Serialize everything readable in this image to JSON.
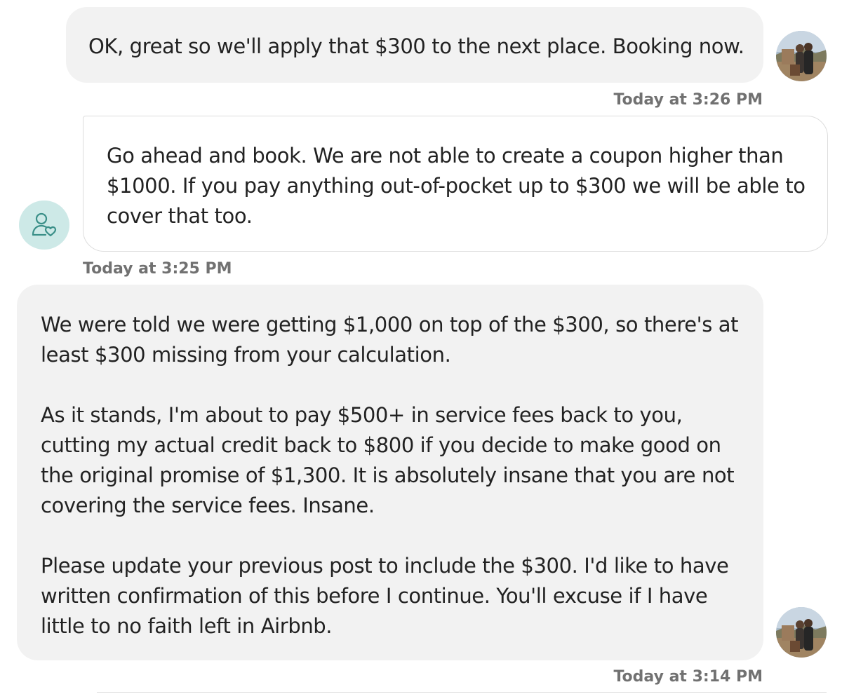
{
  "messages": [
    {
      "id": "msg1",
      "sender": "user",
      "paragraphs": [
        "OK, great so we'll apply that $300 to the next place. Booking now."
      ],
      "timestamp": "Today at 3:26 PM"
    },
    {
      "id": "msg2",
      "sender": "support",
      "paragraphs": [
        "Go ahead and book. We are not able to create a coupon higher than $1000. If you pay anything out-of-pocket up to $300 we will be able to cover that too."
      ],
      "timestamp": "Today at 3:25 PM"
    },
    {
      "id": "msg3",
      "sender": "user",
      "paragraphs": [
        "We were told we were getting $1,000 on top of the $300, so there's at least $300 missing from your calculation.",
        "As it stands, I'm about to pay $500+ in service fees back to you, cutting my actual credit back to $800 if you decide to make good on the original promise of $1,300. It is absolutely insane that you are not covering the service fees. Insane.",
        "Please update your previous post to include the $300. I'd like to have written confirmation of this before I continue. You'll excuse if I have little to no faith left in Airbnb."
      ],
      "timestamp": "Today at 3:14 PM"
    }
  ],
  "icons": {
    "user_avatar": "user-photo-avatar",
    "support_avatar": "support-person-heart-icon"
  },
  "colors": {
    "sent_bubble": "#f2f2f2",
    "received_border": "#dddddd",
    "timestamp": "#717171",
    "support_avatar_bg": "#cde9e7",
    "support_avatar_icon": "#3a8f88"
  }
}
